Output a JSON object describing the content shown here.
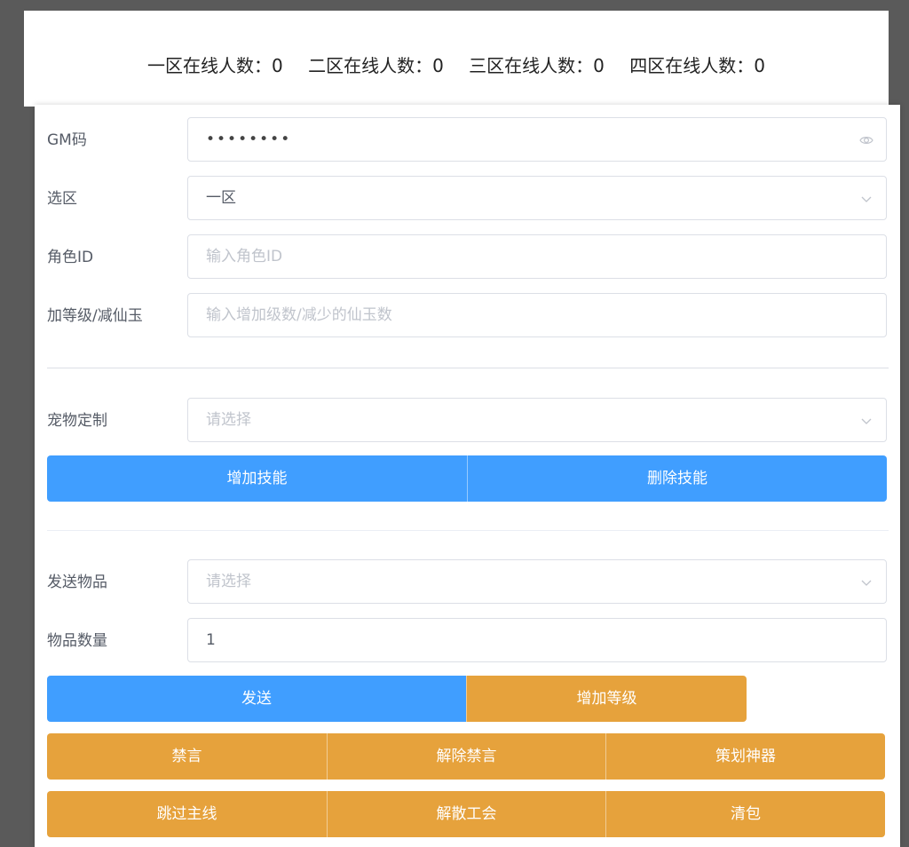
{
  "online_stats": [
    {
      "label": "一区在线人数：",
      "value": "0"
    },
    {
      "label": "二区在线人数：",
      "value": "0"
    },
    {
      "label": "三区在线人数：",
      "value": "0"
    },
    {
      "label": "四区在线人数：",
      "value": "0"
    }
  ],
  "form": {
    "gm_code": {
      "label": "GM码",
      "masked_value": "••••••••",
      "icon": "eye-icon"
    },
    "zone": {
      "label": "选区",
      "value": "一区",
      "icon": "chevron-down-icon"
    },
    "role_id": {
      "label": "角色ID",
      "placeholder": "输入角色ID"
    },
    "level_jade": {
      "label": "加等级/减仙玉",
      "placeholder": "输入增加级数/减少的仙玉数"
    },
    "pet": {
      "label": "宠物定制",
      "placeholder": "请选择",
      "icon": "chevron-down-icon"
    },
    "send_item": {
      "label": "发送物品",
      "placeholder": "请选择",
      "icon": "chevron-down-icon"
    },
    "item_count": {
      "label": "物品数量",
      "value": "1"
    }
  },
  "buttons": {
    "add_skill": "增加技能",
    "delete_skill": "删除技能",
    "send": "发送",
    "add_level": "增加等级",
    "mute": "禁言",
    "unmute": "解除禁言",
    "planner_artifact": "策划神器",
    "skip_main_quest": "跳过主线",
    "disband_guild": "解散工会",
    "clear_bag": "清包"
  },
  "colors": {
    "primary": "#409eff",
    "warning": "#e6a23c",
    "border": "#dcdfe6",
    "placeholder": "#c0c4cc"
  }
}
